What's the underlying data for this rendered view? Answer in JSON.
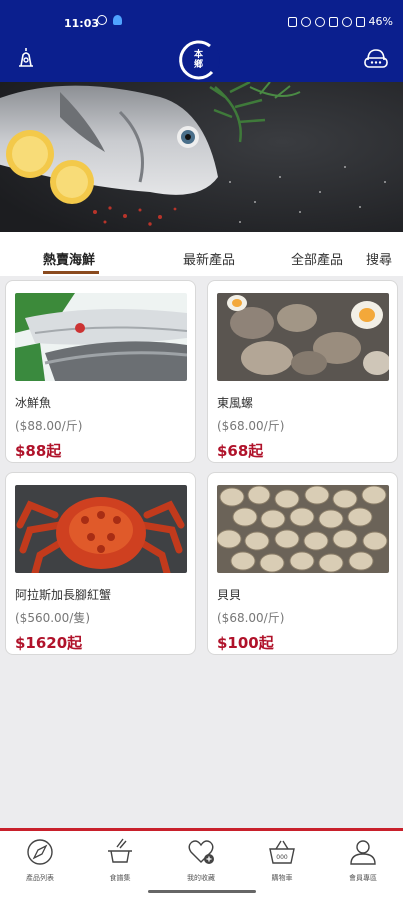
{
  "status_bar": {
    "time": "11:03",
    "battery": "46%"
  },
  "header": {
    "logo_text": "本鄉",
    "left_icon": "bell-tower-icon",
    "right_icon": "headset-icon"
  },
  "tabs": [
    {
      "label": "熱賣海鮮",
      "active": true
    },
    {
      "label": "最新產品",
      "active": false
    },
    {
      "label": "全部產品",
      "active": false
    },
    {
      "label": "搜尋",
      "active": false
    }
  ],
  "products": [
    {
      "name": "冰鮮魚",
      "unit_price": "($88.00/斤)",
      "price": "$88起"
    },
    {
      "name": "東風螺",
      "unit_price": "($68.00/斤)",
      "price": "$68起"
    },
    {
      "name": "阿拉斯加長腳紅蟹",
      "unit_price": "($560.00/隻)",
      "price": "$1620起"
    },
    {
      "name": "貝貝",
      "unit_price": "($68.00/斤)",
      "price": "$100起"
    }
  ],
  "bottom_nav": [
    {
      "label": "產品列表",
      "icon": "compass-icon"
    },
    {
      "label": "食譜集",
      "icon": "recipe-pot-icon"
    },
    {
      "label": "我的收藏",
      "icon": "heart-plus-icon"
    },
    {
      "label": "購物車",
      "icon": "basket-icon"
    },
    {
      "label": "會員專區",
      "icon": "user-icon"
    }
  ],
  "colors": {
    "brand_blue": "#0b1f8e",
    "price_red": "#b0122a",
    "tab_underline": "#8a4a1e",
    "nav_border": "#c8202b"
  }
}
